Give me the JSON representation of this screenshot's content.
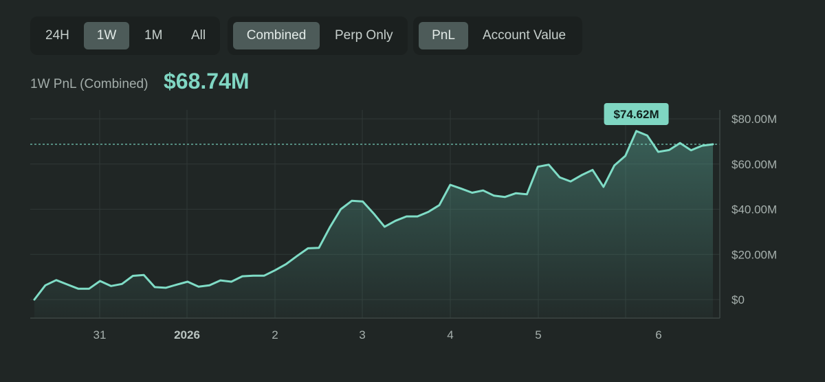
{
  "controls": {
    "range_buttons": [
      {
        "label": "24H",
        "active": false
      },
      {
        "label": "1W",
        "active": true
      },
      {
        "label": "1M",
        "active": false
      },
      {
        "label": "All",
        "active": false
      }
    ],
    "scope_buttons": [
      {
        "label": "Combined",
        "active": true
      },
      {
        "label": "Perp Only",
        "active": false
      }
    ],
    "metric_buttons": [
      {
        "label": "PnL",
        "active": true
      },
      {
        "label": "Account Value",
        "active": false
      }
    ]
  },
  "summary": {
    "label": "1W PnL (Combined)",
    "value": "$68.74M"
  },
  "colors": {
    "line": "#7fdcc6",
    "accent_text": "#80d6c3",
    "badge_bg": "#7fd6c2",
    "grid": "#2f3836",
    "background": "#202625"
  },
  "chart_data": {
    "type": "area",
    "title": "",
    "xlabel": "",
    "ylabel": "",
    "ylim": [
      0,
      80
    ],
    "grid": true,
    "y_ticks": [
      {
        "value": 80,
        "label": "$80.00M"
      },
      {
        "value": 60,
        "label": "$60.00M"
      },
      {
        "value": 40,
        "label": "$40.00M"
      },
      {
        "value": 20,
        "label": "$20.00M"
      },
      {
        "value": 0,
        "label": "$0"
      }
    ],
    "x_ticks": [
      {
        "label": "31",
        "bold": false
      },
      {
        "label": "2026",
        "bold": true
      },
      {
        "label": "2",
        "bold": false
      },
      {
        "label": "3",
        "bold": false
      },
      {
        "label": "4",
        "bold": false
      },
      {
        "label": "5",
        "bold": false
      },
      {
        "label": "6",
        "bold": false
      }
    ],
    "series": [
      {
        "values": [
          0.0,
          6.3,
          8.6,
          6.7,
          4.8,
          4.8,
          8.2,
          6.0,
          6.9,
          10.5,
          10.9,
          5.5,
          5.2,
          6.6,
          7.9,
          5.7,
          6.3,
          8.5,
          7.9,
          10.3,
          10.6,
          10.6,
          13.0,
          15.7,
          19.3,
          22.7,
          22.9,
          32.0,
          40.0,
          43.7,
          43.4,
          38.1,
          32.2,
          34.9,
          36.8,
          36.8,
          38.8,
          41.8,
          50.8,
          49.1,
          47.3,
          48.3,
          46.0,
          45.4,
          47.1,
          46.6,
          58.8,
          59.7,
          54.1,
          52.3,
          55.1,
          57.4,
          49.9,
          59.4,
          63.6,
          74.62,
          72.6,
          65.4,
          66.2,
          69.3,
          66.1,
          68.1,
          68.74
        ]
      }
    ],
    "current_value": 68.74,
    "peak_label": "$74.62M",
    "peak_value": 74.62
  }
}
